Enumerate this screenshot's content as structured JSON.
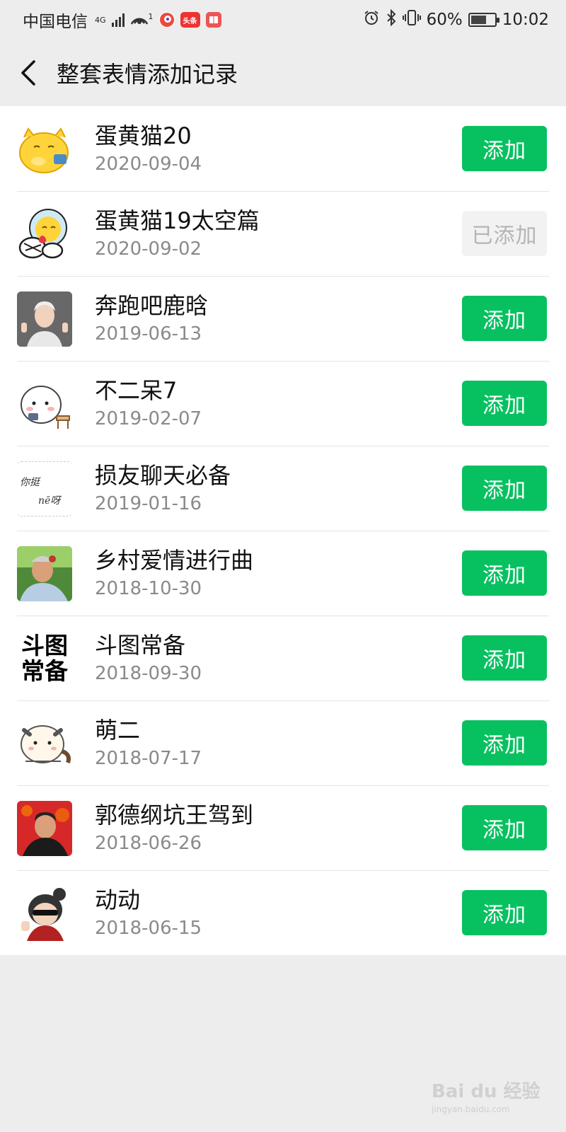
{
  "status_bar": {
    "carrier": "中国电信",
    "network": "4G",
    "hotspot_count": "1",
    "app_badge": "头条",
    "battery": "60%",
    "time": "10:02"
  },
  "nav": {
    "title": "整套表情添加记录"
  },
  "items": [
    {
      "name": "蛋黄猫20",
      "date": "2020-09-04",
      "button": "添加",
      "added": false
    },
    {
      "name": "蛋黄猫19太空篇",
      "date": "2020-09-02",
      "button": "已添加",
      "added": true
    },
    {
      "name": "奔跑吧鹿晗",
      "date": "2019-06-13",
      "button": "添加",
      "added": false
    },
    {
      "name": "不二呆7",
      "date": "2019-02-07",
      "button": "添加",
      "added": false
    },
    {
      "name": "损友聊天必备",
      "date": "2019-01-16",
      "button": "添加",
      "added": false
    },
    {
      "name": "乡村爱情进行曲",
      "date": "2018-10-30",
      "button": "添加",
      "added": false
    },
    {
      "name": "斗图常备",
      "date": "2018-09-30",
      "button": "添加",
      "added": false
    },
    {
      "name": "萌二",
      "date": "2018-07-17",
      "button": "添加",
      "added": false
    },
    {
      "name": "郭德纲坑王驾到",
      "date": "2018-06-26",
      "button": "添加",
      "added": false
    },
    {
      "name": "动动",
      "date": "2018-06-15",
      "button": "添加",
      "added": false
    }
  ],
  "thumb_text": {
    "t5_line1": "你挺",
    "t5_line2": "nē呀",
    "t7_line1": "斗图",
    "t7_line2": "常备"
  },
  "watermark": {
    "brand": "Bai du 经验",
    "url": "jingyan.baidu.com"
  },
  "colors": {
    "accent_green": "#07c160",
    "added_bg": "#f2f2f2",
    "page_bg": "#ededed"
  }
}
